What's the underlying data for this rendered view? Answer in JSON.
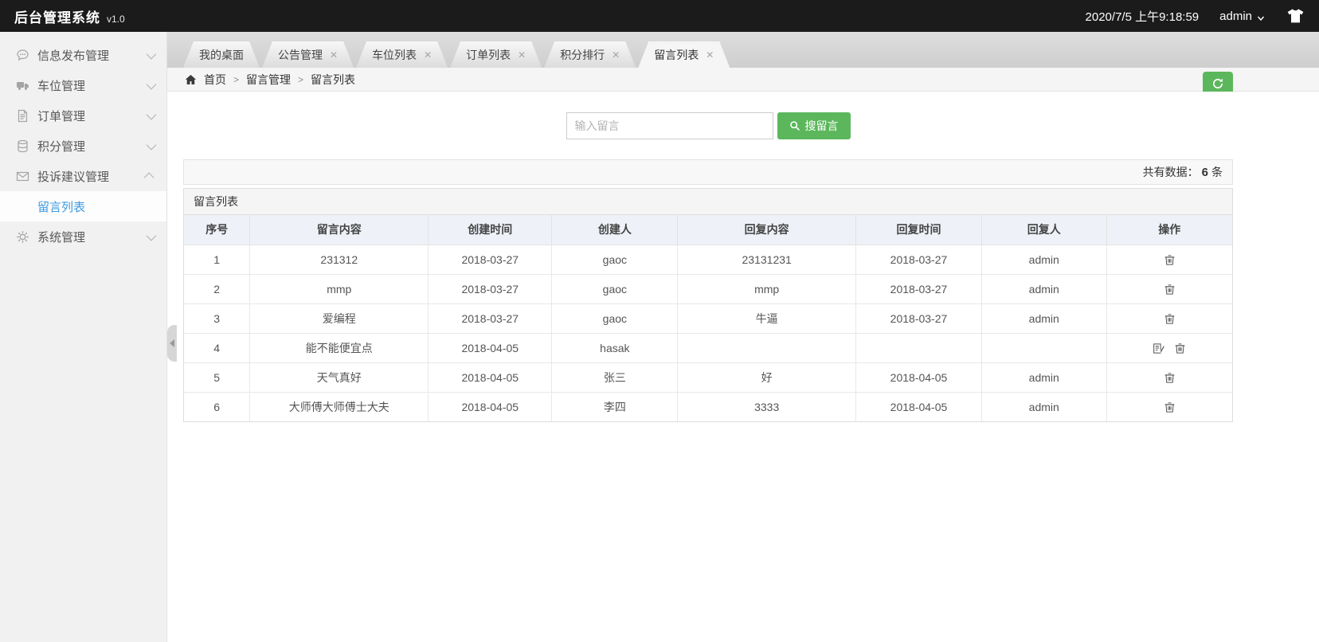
{
  "header": {
    "title": "后台管理系统",
    "version": "v1.0",
    "datetime": "2020/7/5 上午9:18:59",
    "username": "admin"
  },
  "sidebar": {
    "items": [
      {
        "id": "info-publish",
        "label": "信息发布管理",
        "icon": "comment-icon",
        "expanded": false
      },
      {
        "id": "parking",
        "label": "车位管理",
        "icon": "truck-icon",
        "expanded": false
      },
      {
        "id": "orders",
        "label": "订单管理",
        "icon": "file-icon",
        "expanded": false
      },
      {
        "id": "points",
        "label": "积分管理",
        "icon": "database-icon",
        "expanded": false
      },
      {
        "id": "complaints",
        "label": "投诉建议管理",
        "icon": "envelope-icon",
        "expanded": true,
        "children": [
          {
            "id": "message-list",
            "label": "留言列表",
            "active": true
          }
        ]
      },
      {
        "id": "system",
        "label": "系统管理",
        "icon": "gear-icon",
        "expanded": false
      }
    ]
  },
  "tabs": [
    {
      "id": "desktop",
      "label": "我的桌面",
      "closable": false,
      "active": false
    },
    {
      "id": "notice",
      "label": "公告管理",
      "closable": true,
      "active": false
    },
    {
      "id": "parking-list",
      "label": "车位列表",
      "closable": true,
      "active": false
    },
    {
      "id": "order-list",
      "label": "订单列表",
      "closable": true,
      "active": false
    },
    {
      "id": "points-rank",
      "label": "积分排行",
      "closable": true,
      "active": false
    },
    {
      "id": "message-list",
      "label": "留言列表",
      "closable": true,
      "active": true
    }
  ],
  "breadcrumb": [
    "首页",
    "留言管理",
    "留言列表"
  ],
  "search": {
    "placeholder": "输入留言",
    "button_label": "搜留言"
  },
  "summary": {
    "prefix": "共有数据：",
    "count": "6",
    "suffix": "条"
  },
  "table": {
    "panel_title": "留言列表",
    "columns": [
      "序号",
      "留言内容",
      "创建时间",
      "创建人",
      "回复内容",
      "回复时间",
      "回复人",
      "操作"
    ],
    "rows": [
      {
        "no": "1",
        "content": "231312",
        "created": "2018-03-27",
        "creator": "gaoc",
        "reply": "23131231",
        "replied": "2018-03-27",
        "replier": "admin",
        "actions": [
          "delete"
        ]
      },
      {
        "no": "2",
        "content": "mmp",
        "created": "2018-03-27",
        "creator": "gaoc",
        "reply": "mmp",
        "replied": "2018-03-27",
        "replier": "admin",
        "actions": [
          "delete"
        ]
      },
      {
        "no": "3",
        "content": "爱编程",
        "created": "2018-03-27",
        "creator": "gaoc",
        "reply": "牛逼",
        "replied": "2018-03-27",
        "replier": "admin",
        "actions": [
          "delete"
        ]
      },
      {
        "no": "4",
        "content": "能不能便宜点",
        "created": "2018-04-05",
        "creator": "hasak",
        "reply": "",
        "replied": "",
        "replier": "",
        "actions": [
          "reply",
          "delete"
        ]
      },
      {
        "no": "5",
        "content": "天气真好",
        "created": "2018-04-05",
        "creator": "张三",
        "reply": "好",
        "replied": "2018-04-05",
        "replier": "admin",
        "actions": [
          "delete"
        ]
      },
      {
        "no": "6",
        "content": "大师傅大师傅士大夫",
        "created": "2018-04-05",
        "creator": "李四",
        "reply": "3333",
        "replied": "2018-04-05",
        "replier": "admin",
        "actions": [
          "delete"
        ]
      }
    ]
  },
  "colors": {
    "topbar_bg": "#1b1b1b",
    "accent_green": "#5cb75c",
    "active_link_blue": "#3d9ae0",
    "table_header_bg": "#eef2f8",
    "sidebar_bg": "#f1f1f1"
  }
}
